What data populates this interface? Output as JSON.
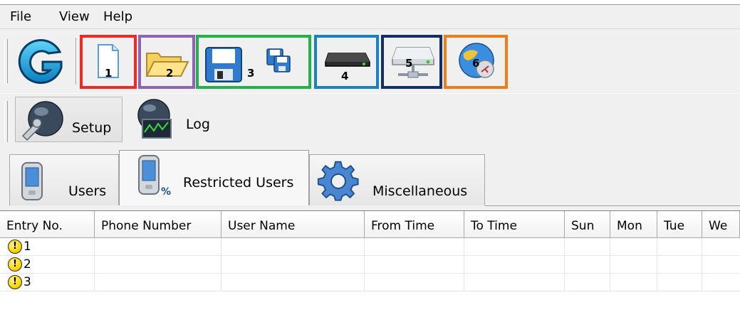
{
  "menu": {
    "items": [
      "File",
      "View",
      "Help"
    ]
  },
  "toolbar": {
    "buttons": [
      {
        "number": "1",
        "icon": "new-document-icon",
        "border_color": "#ee2a24"
      },
      {
        "number": "2",
        "icon": "open-folder-icon",
        "border_color": "#8e62b5"
      },
      {
        "number": "3",
        "icon": "save-icon",
        "border_color": "#22b04a"
      },
      {
        "number": "4",
        "icon": "modem-device-icon",
        "border_color": "#1880c4"
      },
      {
        "number": "5",
        "icon": "network-drive-icon",
        "border_color": "#0f2f6a"
      },
      {
        "number": "6",
        "icon": "globe-settings-icon",
        "border_color": "#ed7d18"
      }
    ]
  },
  "views": {
    "setup_label": "Setup",
    "log_label": "Log"
  },
  "tabs": [
    {
      "label": "Users",
      "icon": "phone-icon"
    },
    {
      "label": "Restricted Users",
      "icon": "phone-restricted-icon"
    },
    {
      "label": "Miscellaneous",
      "icon": "gear-icon"
    }
  ],
  "grid": {
    "columns": [
      "Entry No.",
      "Phone Number",
      "User Name",
      "From Time",
      "To Time",
      "Sun",
      "Mon",
      "Tue",
      "We"
    ],
    "rows": [
      {
        "icon": "warning-icon",
        "entry": "1"
      },
      {
        "icon": "warning-icon",
        "entry": "2"
      },
      {
        "icon": "warning-icon",
        "entry": "3"
      }
    ]
  }
}
